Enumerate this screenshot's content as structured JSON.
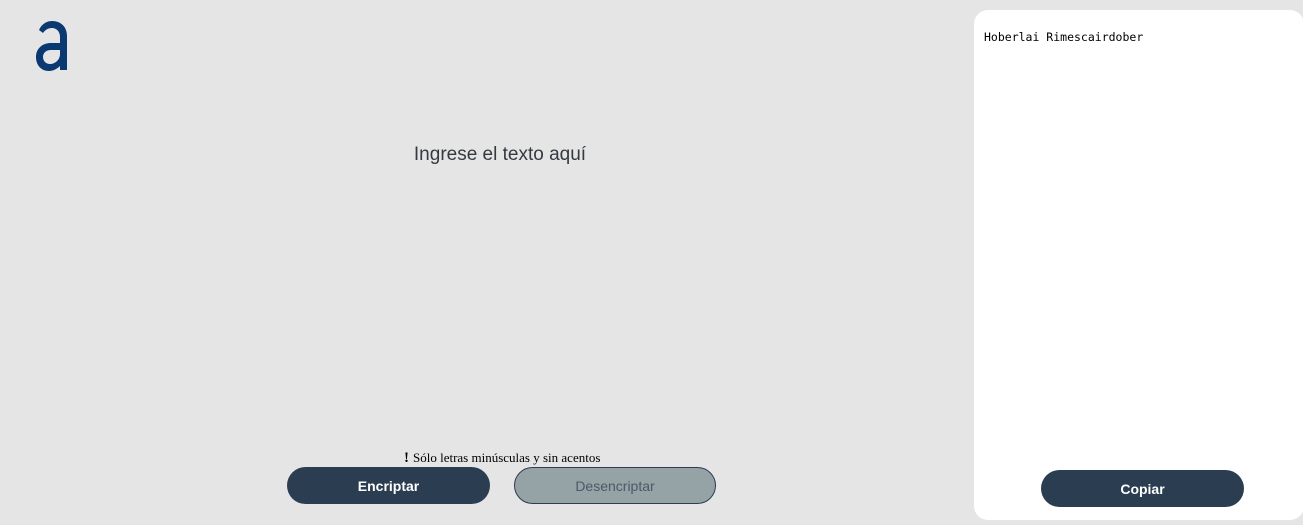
{
  "brand": {
    "logo_icon": "alura-a-logo-icon",
    "color": "#0a3871"
  },
  "editor": {
    "placeholder": "Ingrese el texto aquí",
    "value": ""
  },
  "warning": {
    "icon": "exclamation-icon",
    "bang": "!",
    "text": "Sólo letras minúsculas y sin acentos"
  },
  "actions": {
    "encrypt_label": "Encriptar",
    "decrypt_label": "Desencriptar"
  },
  "output": {
    "text": "Hoberlai Rimescairdober",
    "copy_label": "Copiar"
  },
  "colors": {
    "background": "#e5e5e5",
    "primary_button": "#2b3d51",
    "secondary_button": "#95a3a6",
    "panel": "#ffffff"
  }
}
